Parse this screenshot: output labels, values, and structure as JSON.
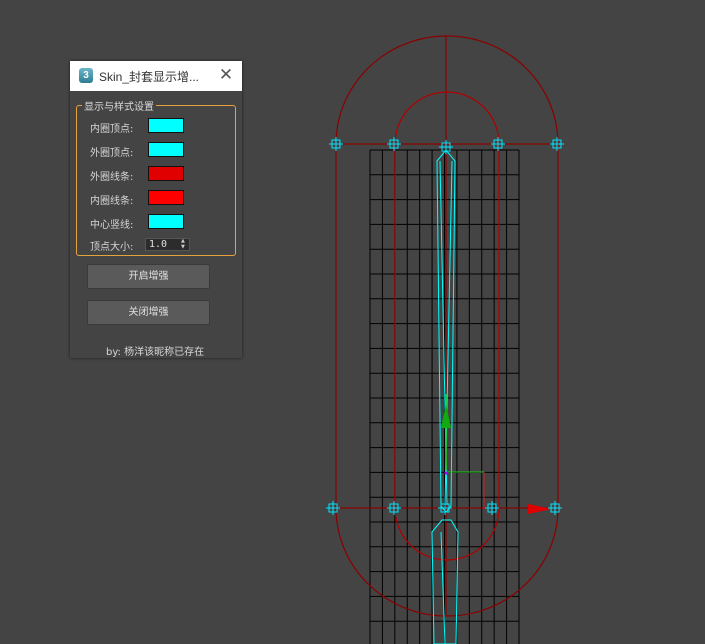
{
  "window": {
    "title": "Skin_封套显示增...",
    "icon_glyph": "3",
    "close_glyph": "✕"
  },
  "settings_group": {
    "title": "显示与样式设置",
    "rows": [
      {
        "label": "内圈顶点:",
        "color": "#00ffff"
      },
      {
        "label": "外圈顶点:",
        "color": "#00ffff"
      },
      {
        "label": "外圈线条:",
        "color": "#e00000"
      },
      {
        "label": "内圈线条:",
        "color": "#ff0000"
      },
      {
        "label": "中心竖线:",
        "color": "#00ffff"
      }
    ],
    "vertex_size": {
      "label": "顶点大小:",
      "value": "1.0"
    }
  },
  "buttons": {
    "enable": "开启增强",
    "disable": "关闭增强"
  },
  "credit": "by: 杨洋该昵称已存在",
  "viewport": {
    "background": "#444444",
    "envelope_color": "#8a0000",
    "vertex_color": "#00e5ff",
    "bone_color": "#00ffff",
    "grid_color": "#000000"
  }
}
